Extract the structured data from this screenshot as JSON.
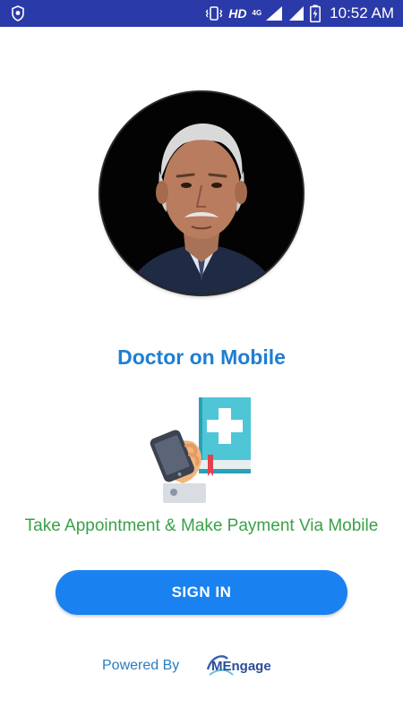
{
  "status_bar": {
    "network_label": "HD",
    "network_type": "4G",
    "time": "10:52 AM",
    "icons": [
      "shield-icon",
      "vibrate-icon",
      "signal-icon",
      "battery-icon"
    ],
    "background": "#2a3aa8"
  },
  "profile": {
    "avatar_icon": "doctor-avatar"
  },
  "app": {
    "title": "Doctor on Mobile",
    "tagline": "Take Appointment & Make Payment Via Mobile",
    "accent_color": "#1e7ed2",
    "tagline_color": "#3aa047"
  },
  "actions": {
    "signin_label": "SIGN IN",
    "button_color": "#1a82f0"
  },
  "footer": {
    "powered_by_label": "Powered By",
    "brand_name": "MEngage"
  }
}
